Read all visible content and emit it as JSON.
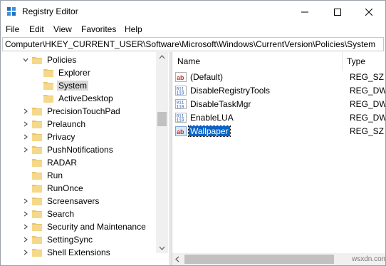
{
  "window": {
    "title": "Registry Editor",
    "accent": "#0a64c8"
  },
  "menu": [
    "File",
    "Edit",
    "View",
    "Favorites",
    "Help"
  ],
  "address": "Computer\\HKEY_CURRENT_USER\\Software\\Microsoft\\Windows\\CurrentVersion\\Policies\\System",
  "tree": [
    {
      "label": "Policies",
      "expanded": true
    },
    {
      "label": "Explorer"
    },
    {
      "label": "System",
      "selected": true
    },
    {
      "label": "ActiveDesktop"
    },
    {
      "label": "PrecisionTouchPad"
    },
    {
      "label": "Prelaunch"
    },
    {
      "label": "Privacy"
    },
    {
      "label": "PushNotifications"
    },
    {
      "label": "RADAR"
    },
    {
      "label": "Run"
    },
    {
      "label": "RunOnce"
    },
    {
      "label": "Screensavers"
    },
    {
      "label": "Search"
    },
    {
      "label": "Security and Maintenance"
    },
    {
      "label": "SettingSync"
    },
    {
      "label": "Shell Extensions"
    }
  ],
  "list": {
    "headers": {
      "name": "Name",
      "type": "Type"
    },
    "rows": [
      {
        "name": "(Default)",
        "type": "REG_SZ",
        "icon": "string-value-icon"
      },
      {
        "name": "DisableRegistryTools",
        "type": "REG_DWO",
        "icon": "dword-value-icon"
      },
      {
        "name": "DisableTaskMgr",
        "type": "REG_DWO",
        "icon": "dword-value-icon"
      },
      {
        "name": "EnableLUA",
        "type": "REG_DWO",
        "icon": "dword-value-icon"
      },
      {
        "name": "Wallpaper",
        "type": "REG_SZ",
        "icon": "string-value-icon",
        "selected": true
      }
    ]
  },
  "watermark": "wsxdn.com"
}
